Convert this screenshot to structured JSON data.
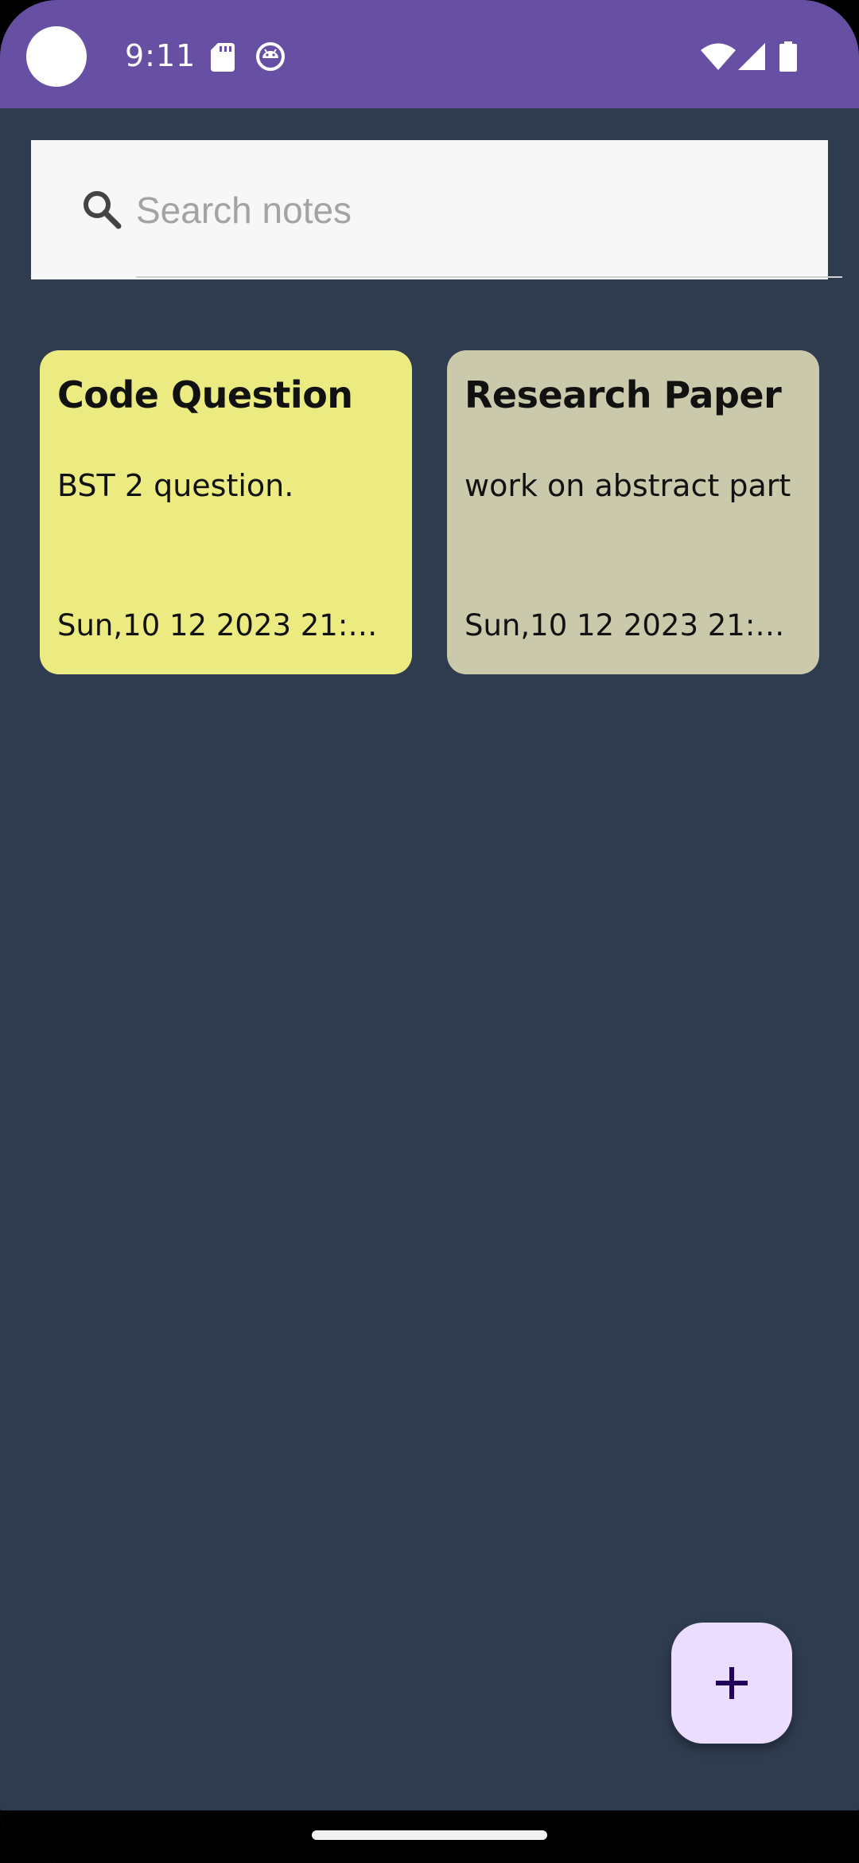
{
  "status_bar": {
    "time": "9:11",
    "background": "#6750a4",
    "icons": [
      "sd-card-icon",
      "android-icon",
      "wifi-icon",
      "signal-icon",
      "battery-icon"
    ]
  },
  "search": {
    "placeholder": "Search notes",
    "value": "",
    "icon": "search-icon"
  },
  "notes": [
    {
      "title": "Code Question",
      "body": "BST 2 question.",
      "date": "Sun,10 12 2023 21:10...",
      "color": "#ebeb82"
    },
    {
      "title": "Research Paper",
      "body": "work on abstract part",
      "date": "Sun,10 12 2023 21:10...",
      "color": "#cbc9ab"
    }
  ],
  "fab": {
    "icon": "plus-icon",
    "color": "#eaddff"
  },
  "theme": {
    "background": "#2f3c50"
  }
}
